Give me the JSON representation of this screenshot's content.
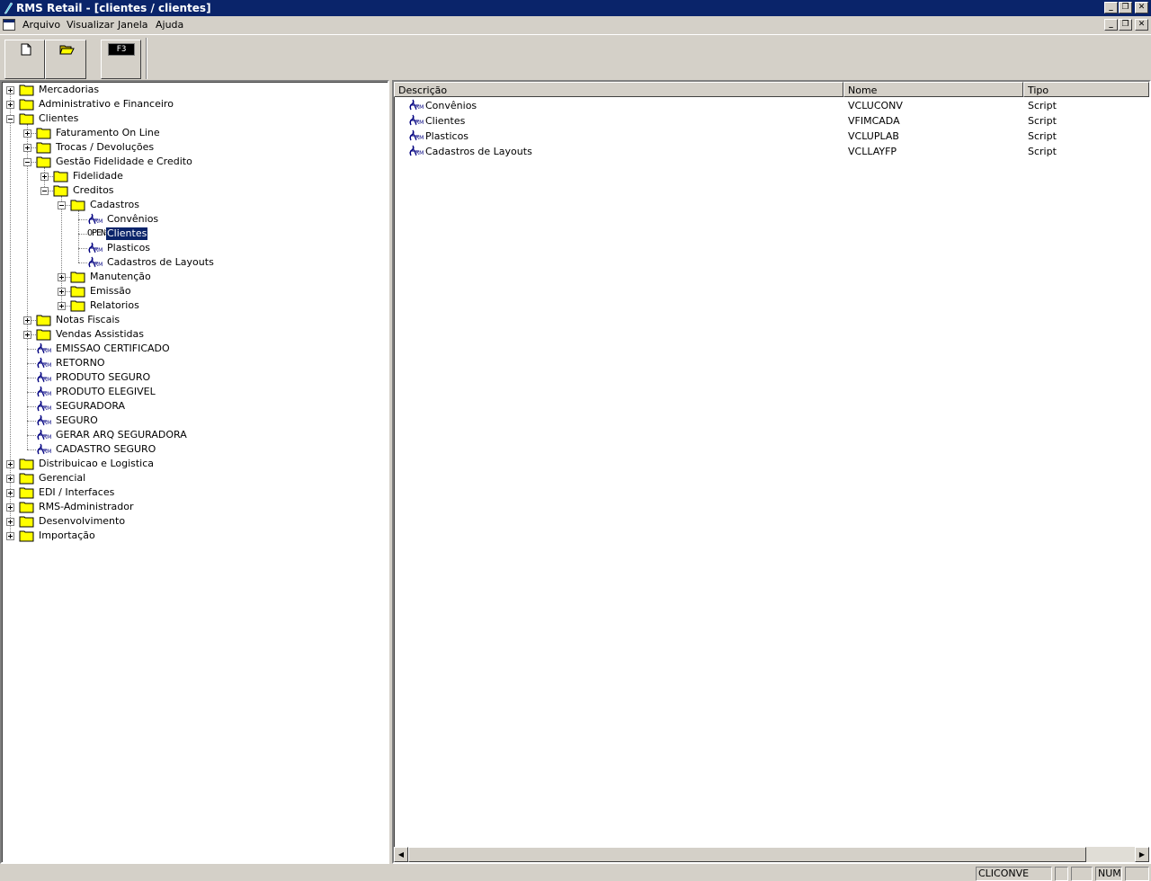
{
  "window": {
    "title": "RMS Retail - [clientes / clientes]",
    "controls": {
      "minimize": "_",
      "restore": "❐",
      "close": "✕"
    }
  },
  "menu": [
    {
      "label": "Arquivo"
    },
    {
      "label": "Visualizar"
    },
    {
      "label": "Janela"
    },
    {
      "label": "Ajuda"
    }
  ],
  "toolbar": {
    "buttons": [
      {
        "name": "new-document-icon"
      },
      {
        "name": "open-folder-icon"
      },
      {
        "name": "f3-key-icon",
        "label": "F3"
      }
    ]
  },
  "tree": {
    "open_icon_text": "OPEN",
    "items": [
      {
        "label": "Mercadorias",
        "level": 0,
        "kind": "folder",
        "expander": "plus"
      },
      {
        "label": "Administrativo e Financeiro",
        "level": 0,
        "kind": "folder",
        "expander": "plus"
      },
      {
        "label": "Clientes",
        "level": 0,
        "kind": "folder",
        "expander": "minus"
      },
      {
        "label": "Faturamento On Line",
        "level": 1,
        "kind": "folder",
        "expander": "plus"
      },
      {
        "label": "Trocas / Devoluções",
        "level": 1,
        "kind": "folder",
        "expander": "plus"
      },
      {
        "label": "Gestão Fidelidade e Credito",
        "level": 1,
        "kind": "folder",
        "expander": "minus"
      },
      {
        "label": "Fidelidade",
        "level": 2,
        "kind": "folder",
        "expander": "plus"
      },
      {
        "label": "Creditos",
        "level": 2,
        "kind": "folder",
        "expander": "minus"
      },
      {
        "label": "Cadastros",
        "level": 3,
        "kind": "folder",
        "expander": "minus"
      },
      {
        "label": "Convênios",
        "level": 4,
        "kind": "script"
      },
      {
        "label": "Clientes",
        "level": 4,
        "kind": "open",
        "selected": true
      },
      {
        "label": "Plasticos",
        "level": 4,
        "kind": "script"
      },
      {
        "label": "Cadastros de Layouts",
        "level": 4,
        "kind": "script"
      },
      {
        "label": "Manutenção",
        "level": 3,
        "kind": "folder",
        "expander": "plus"
      },
      {
        "label": "Emissão",
        "level": 3,
        "kind": "folder",
        "expander": "plus"
      },
      {
        "label": "Relatorios",
        "level": 3,
        "kind": "folder",
        "expander": "plus"
      },
      {
        "label": "Notas Fiscais",
        "level": 1,
        "kind": "folder",
        "expander": "plus"
      },
      {
        "label": "Vendas Assistidas",
        "level": 1,
        "kind": "folder",
        "expander": "plus"
      },
      {
        "label": "EMISSAO CERTIFICADO",
        "level": 1,
        "kind": "script"
      },
      {
        "label": "RETORNO",
        "level": 1,
        "kind": "script"
      },
      {
        "label": "PRODUTO SEGURO",
        "level": 1,
        "kind": "script"
      },
      {
        "label": "PRODUTO ELEGIVEL",
        "level": 1,
        "kind": "script"
      },
      {
        "label": "SEGURADORA",
        "level": 1,
        "kind": "script"
      },
      {
        "label": "SEGURO",
        "level": 1,
        "kind": "script"
      },
      {
        "label": "GERAR ARQ SEGURADORA",
        "level": 1,
        "kind": "script"
      },
      {
        "label": "CADASTRO SEGURO",
        "level": 1,
        "kind": "script"
      },
      {
        "label": "Distribuicao e Logistica",
        "level": 0,
        "kind": "folder",
        "expander": "plus"
      },
      {
        "label": "Gerencial",
        "level": 0,
        "kind": "folder",
        "expander": "plus"
      },
      {
        "label": "EDI / Interfaces",
        "level": 0,
        "kind": "folder",
        "expander": "plus"
      },
      {
        "label": "RMS-Administrador",
        "level": 0,
        "kind": "folder",
        "expander": "plus"
      },
      {
        "label": "Desenvolvimento",
        "level": 0,
        "kind": "folder",
        "expander": "plus"
      },
      {
        "label": "Importação",
        "level": 0,
        "kind": "folder",
        "expander": "plus"
      }
    ]
  },
  "list": {
    "columns": [
      "Descrição",
      "Nome",
      "Tipo"
    ],
    "rows": [
      {
        "descricao": "Convênios",
        "nome": "VCLUCONV",
        "tipo": "Script"
      },
      {
        "descricao": "Clientes",
        "nome": "VFIMCADA",
        "tipo": "Script"
      },
      {
        "descricao": "Plasticos",
        "nome": "VCLUPLAB",
        "tipo": "Script"
      },
      {
        "descricao": "Cadastros de Layouts",
        "nome": "VCLLAYFP",
        "tipo": "Script"
      }
    ]
  },
  "scrollbar": {
    "left_arrow": "◀",
    "right_arrow": "▶"
  },
  "status": [
    "CLICONVE",
    "",
    "",
    "NUM",
    ""
  ],
  "colors": {
    "title_bar": "#0a246a",
    "face": "#d4d0c8",
    "folder": "#ffff00",
    "script_icon": "#000080"
  }
}
